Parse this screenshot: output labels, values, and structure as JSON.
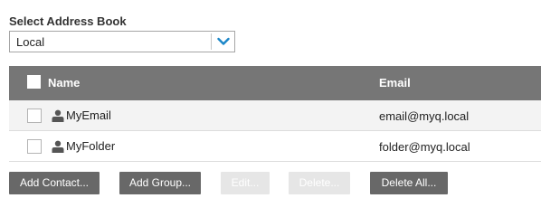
{
  "address_book": {
    "label": "Select Address Book",
    "selected": "Local"
  },
  "grid": {
    "columns": {
      "name": "Name",
      "email": "Email"
    },
    "rows": [
      {
        "name": "MyEmail",
        "email": "email@myq.local",
        "icon": "person-icon"
      },
      {
        "name": "MyFolder",
        "email": "folder@myq.local",
        "icon": "person-icon"
      }
    ]
  },
  "buttons": {
    "add_contact": "Add Contact...",
    "add_group": "Add Group...",
    "edit": "Edit...",
    "delete": "Delete...",
    "delete_all": "Delete All..."
  },
  "colors": {
    "header_bg": "#767676",
    "button_bg": "#686868",
    "button_disabled_bg": "#e6e6e6",
    "chevron": "#1a86c8"
  }
}
